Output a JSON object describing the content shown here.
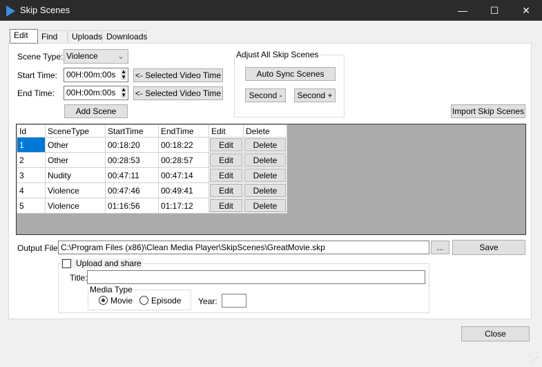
{
  "window": {
    "title": "Skip Scenes",
    "minimize": "—",
    "maximize": "☐",
    "close": "✕"
  },
  "tabs": [
    {
      "label": "Edit"
    },
    {
      "label": "Find"
    },
    {
      "label": "Uploads"
    },
    {
      "label": "Downloads"
    }
  ],
  "form": {
    "scene_type_label": "Scene Type:",
    "scene_type_value": "Violence",
    "start_time_label": "Start Time:",
    "start_time_value": "00H:00m:00s",
    "end_time_label": "End Time:",
    "end_time_value": "00H:00m:00s",
    "selected_video_time": "<- Selected Video Time",
    "add_scene": "Add Scene"
  },
  "adjust": {
    "legend": "Adjust All Skip Scenes",
    "auto_sync": "Auto Sync Scenes",
    "second_minus": "Second -",
    "second_plus": "Second +"
  },
  "import_button": "Import Skip Scenes",
  "table": {
    "headers": [
      "Id",
      "SceneType",
      "StartTime",
      "EndTime",
      "Edit",
      "Delete"
    ],
    "rows": [
      {
        "id": "1",
        "type": "Other",
        "start": "00:18:20",
        "end": "00:18:22",
        "edit": "Edit",
        "delete": "Delete"
      },
      {
        "id": "2",
        "type": "Other",
        "start": "00:28:53",
        "end": "00:28:57",
        "edit": "Edit",
        "delete": "Delete"
      },
      {
        "id": "3",
        "type": "Nudity",
        "start": "00:47:11",
        "end": "00:47:14",
        "edit": "Edit",
        "delete": "Delete"
      },
      {
        "id": "4",
        "type": "Violence",
        "start": "00:47:46",
        "end": "00:49:41",
        "edit": "Edit",
        "delete": "Delete"
      },
      {
        "id": "5",
        "type": "Violence",
        "start": "01:16:56",
        "end": "01:17:12",
        "edit": "Edit",
        "delete": "Delete"
      }
    ]
  },
  "output": {
    "label": "Output File:",
    "value": "C:\\Program Files (x86)\\Clean Media Player\\SkipScenes\\GreatMovie.skp",
    "browse": "...",
    "save": "Save"
  },
  "upload": {
    "checkbox_label": "Upload and share",
    "checked": false,
    "title_label": "Title:",
    "title_value": "",
    "media_type_legend": "Media Type",
    "movie": "Movie",
    "episode": "Episode",
    "selected": "Movie",
    "year_label": "Year:",
    "year_value": ""
  },
  "close_button": "Close"
}
